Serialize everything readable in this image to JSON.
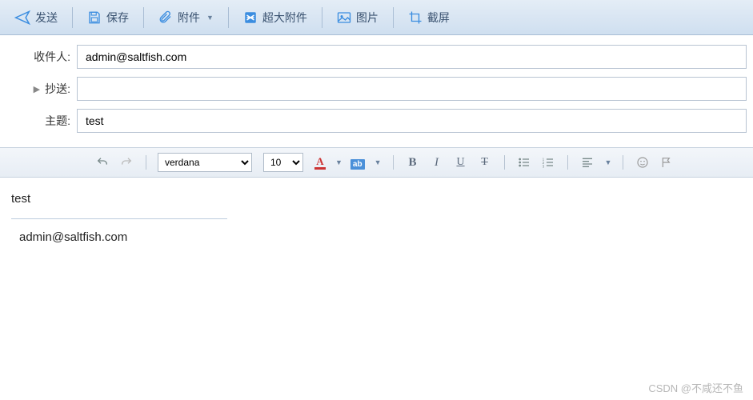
{
  "toolbar": {
    "send": "发送",
    "save": "保存",
    "attach": "附件",
    "big_attach": "超大附件",
    "image": "图片",
    "screenshot": "截屏"
  },
  "fields": {
    "to_label": "收件人:",
    "to_value": "admin@saltfish.com",
    "cc_label": "抄送:",
    "cc_value": "",
    "subject_label": "主题:",
    "subject_value": "test"
  },
  "editor": {
    "font_name": "verdana",
    "font_size": "10"
  },
  "body": {
    "text": "test",
    "signature": "admin@saltfish.com"
  },
  "watermark": "CSDN @不咸还不鱼"
}
